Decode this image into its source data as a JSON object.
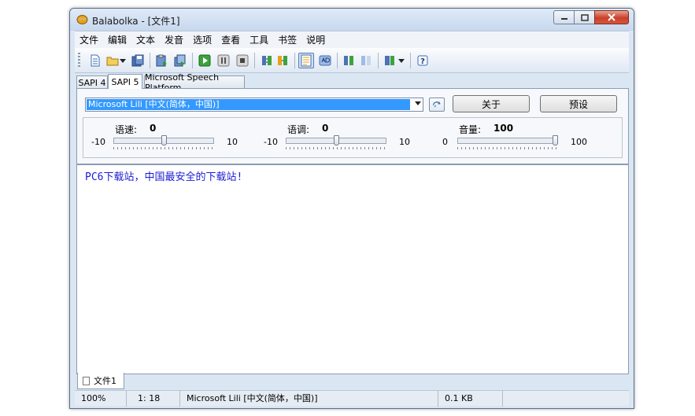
{
  "window": {
    "title": "Balabolka - [文件1]"
  },
  "menu": [
    "文件",
    "编辑",
    "文本",
    "发音",
    "选项",
    "查看",
    "工具",
    "书签",
    "说明"
  ],
  "tabs": [
    "SAPI 4",
    "SAPI 5",
    "Microsoft Speech Platform"
  ],
  "voice": {
    "selected": "Microsoft Lili [中文(简体，中国)]",
    "about_label": "关于",
    "preset_label": "预设"
  },
  "sliders": {
    "rate": {
      "label": "语速:",
      "value": "0",
      "min": "-10",
      "max": "10",
      "level": 0.5
    },
    "pitch": {
      "label": "语调:",
      "value": "0",
      "min": "-10",
      "max": "10",
      "level": 0.5
    },
    "volume": {
      "label": "音量:",
      "value": "100",
      "min": "0",
      "max": "100",
      "level": 1.0
    }
  },
  "editor": {
    "text": "PC6下载站，中国最安全的下载站!"
  },
  "doc_tab": "文件1",
  "status": {
    "zoom": "100%",
    "position": "1:  18",
    "voice": "Microsoft Lili [中文(简体，中国)]",
    "size": "0.1 KB"
  },
  "colors": {
    "text_blue": "#1b1bd6",
    "selection": "#3399ff",
    "close_red": "#c9402a"
  }
}
